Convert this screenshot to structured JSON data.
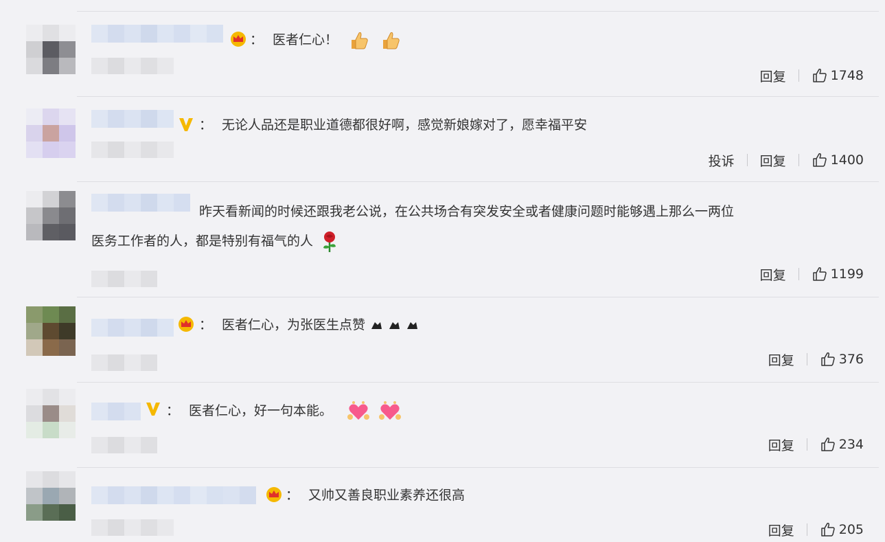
{
  "comments": [
    {
      "text": "医者仁心！",
      "badge": "crown-icon",
      "emojis": [
        "thumbs-up-icon",
        "thumbs-up-icon"
      ],
      "actions": {
        "reply": "回复",
        "likes": "1748"
      }
    },
    {
      "text": "无论人品还是职业道德都很好啊，感觉新娘嫁对了，愿幸福平安",
      "badge": "verified-v-icon",
      "actions": {
        "report": "投诉",
        "reply": "回复",
        "likes": "1400"
      }
    },
    {
      "text_line1": "昨天看新闻的时候还跟我老公说，在公共场合有突发安全或者健康问题时能够遇上那么一两位",
      "text_line2": "医务工作者的人，都是特别有福气的人",
      "emojis": [
        "rose-icon"
      ],
      "actions": {
        "reply": "回复",
        "likes": "1199"
      }
    },
    {
      "text": "医者仁心，为张医生点赞",
      "badge": "crown-icon",
      "emojis": [
        "clap-icon",
        "clap-icon",
        "clap-icon"
      ],
      "actions": {
        "reply": "回复",
        "likes": "376"
      }
    },
    {
      "text": "医者仁心，好一句本能。",
      "badge": "verified-v-icon",
      "emojis": [
        "heart-hands-icon",
        "heart-hands-icon"
      ],
      "actions": {
        "reply": "回复",
        "likes": "234"
      }
    },
    {
      "text": "又帅又善良职业素养还很高",
      "badge": "crown-icon",
      "actions": {
        "reply": "回复",
        "likes": "205"
      }
    }
  ],
  "colon": "：",
  "colors": {
    "background": "#f2f2f5",
    "text": "#333333",
    "vip_gold": "#f5b800",
    "divider": "#dedee2"
  }
}
